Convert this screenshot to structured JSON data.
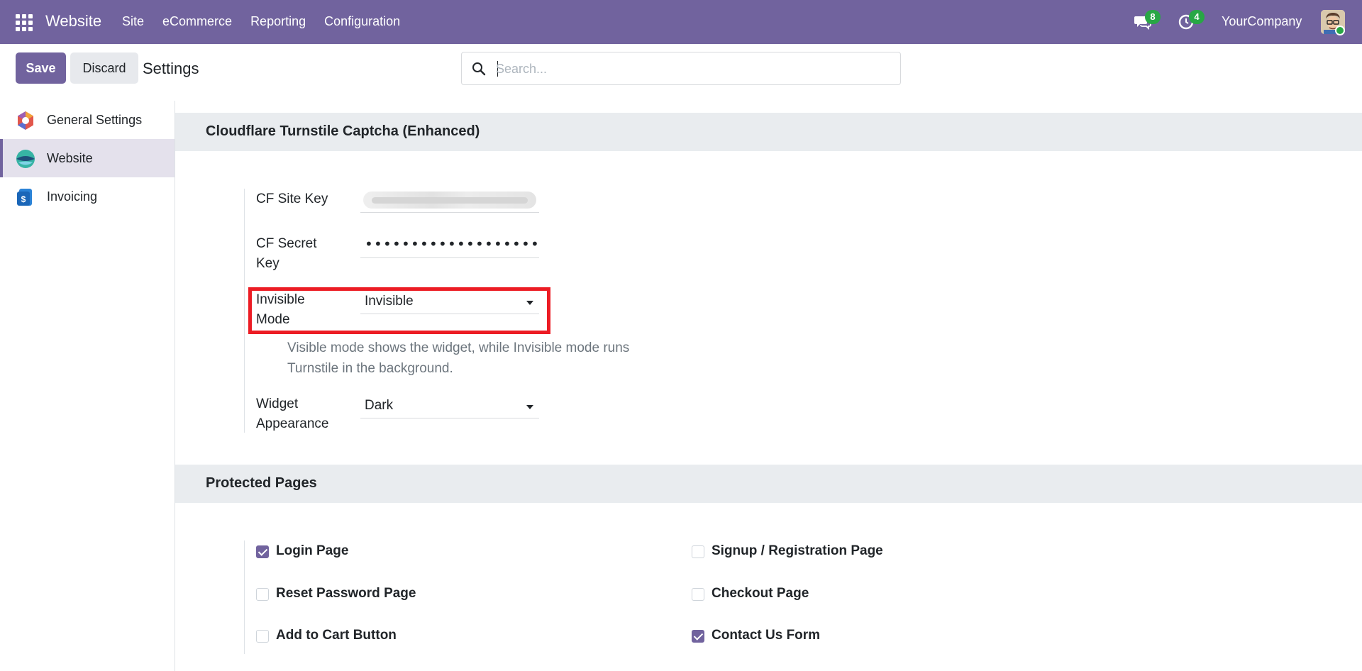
{
  "navbar": {
    "brand": "Website",
    "menu": [
      "Site",
      "eCommerce",
      "Reporting",
      "Configuration"
    ],
    "messages_count": "8",
    "activities_count": "4",
    "company": "YourCompany",
    "accent_color": "#71639e",
    "badge_color": "#28a745"
  },
  "control_panel": {
    "save_label": "Save",
    "discard_label": "Discard",
    "title": "Settings",
    "search_placeholder": "Search..."
  },
  "sidebar": {
    "items": [
      {
        "label": "General Settings",
        "icon": "general-settings-icon",
        "active": false
      },
      {
        "label": "Website",
        "icon": "website-app-icon",
        "active": true
      },
      {
        "label": "Invoicing",
        "icon": "invoicing-app-icon",
        "active": false
      }
    ]
  },
  "turnstile": {
    "heading": "Cloudflare Turnstile Captcha (Enhanced)",
    "site_key_label": "CF Site Key",
    "secret_key_label": "CF Secret Key",
    "secret_key_value": "••••••••••••••••••••••••••••••••",
    "invisible_mode_label": "Invisible Mode",
    "invisible_mode_value": "Invisible",
    "invisible_mode_help": "Visible mode shows the widget, while Invisible mode runs Turnstile in the background.",
    "widget_appearance_label": "Widget Appearance",
    "widget_appearance_value": "Dark",
    "highlight_color": "#ec1c24"
  },
  "protected_pages": {
    "heading": "Protected Pages",
    "options": [
      {
        "label": "Login Page",
        "checked": true
      },
      {
        "label": "Signup / Registration Page",
        "checked": false
      },
      {
        "label": "Reset Password Page",
        "checked": false
      },
      {
        "label": "Checkout Page",
        "checked": false
      },
      {
        "label": "Add to Cart Button",
        "checked": false
      },
      {
        "label": "Contact Us Form",
        "checked": true
      }
    ]
  }
}
